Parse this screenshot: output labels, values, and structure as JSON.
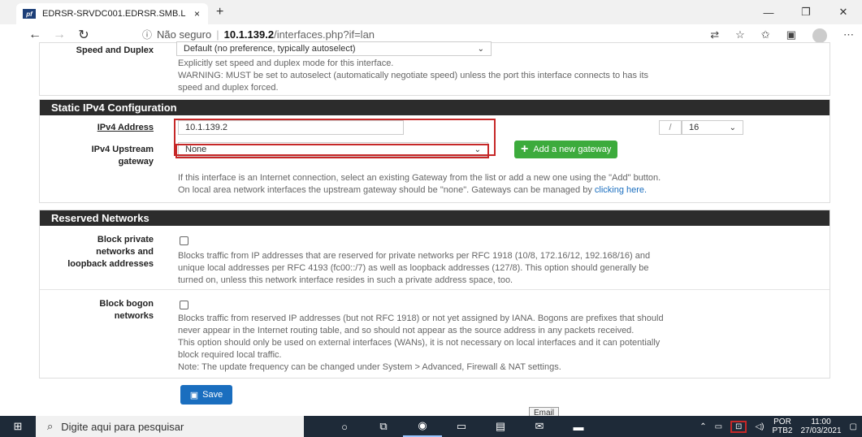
{
  "browser": {
    "tab_title": "EDRSR-SRVDC001.EDRSR.SMB.L",
    "tab_close": "×",
    "new_tab": "+",
    "favicon": "pf",
    "security": "Não seguro",
    "url_host": "10.1.139.2",
    "url_path": "/interfaces.php?if=lan",
    "window_controls": [
      "—",
      "❐",
      "✕"
    ]
  },
  "speed_duplex": {
    "label": "Speed and Duplex",
    "select_value": "Default (no preference, typically autoselect)",
    "help_1": "Explicitly set speed and duplex mode for this interface.",
    "help_2": "WARNING: MUST be set to autoselect (automatically negotiate speed) unless the port this interface connects to has its",
    "help_3": "speed and duplex forced."
  },
  "static_ipv4": {
    "heading": "Static IPv4 Configuration",
    "address_label": "IPv4 Address",
    "address_value": "10.1.139.2",
    "slash": "/",
    "cidr_value": "16",
    "upstream_label_1": "IPv4 Upstream",
    "upstream_label_2": "gateway",
    "upstream_value": "None",
    "add_gateway_label": "Add a new gateway",
    "help_1": "If this interface is an Internet connection, select an existing Gateway from the list or add a new one using the \"Add\" button.",
    "help_2": "On local area network interfaces the upstream gateway should be \"none\". Gateways can be managed by",
    "help_link": "clicking here."
  },
  "reserved": {
    "heading": "Reserved Networks",
    "private_label_1": "Block private",
    "private_label_2": "networks and",
    "private_label_3": "loopback addresses",
    "private_help_1": "Blocks traffic from IP addresses that are reserved for private networks per RFC 1918 (10/8, 172.16/12, 192.168/16) and",
    "private_help_2": "unique local addresses per RFC 4193 (fc00::/7) as well as loopback addresses (127/8). This option should generally be",
    "private_help_3": "turned on, unless this network interface resides in such a private address space, too.",
    "bogon_label_1": "Block bogon",
    "bogon_label_2": "networks",
    "bogon_help_1": "Blocks traffic from reserved IP addresses (but not RFC 1918) or not yet assigned by IANA. Bogons are prefixes that should",
    "bogon_help_2": "never appear in the Internet routing table, and so should not appear as the source address in any packets received.",
    "bogon_help_3": "This option should only be used on external interfaces (WANs), it is not necessary on local interfaces and it can potentially",
    "bogon_help_4": "block required local traffic.",
    "bogon_help_5": "Note: The update frequency can be changed under System > Advanced, Firewall & NAT settings."
  },
  "save_label": "Save",
  "tooltip": "Email",
  "taskbar": {
    "search_placeholder": "Digite aqui para pesquisar",
    "lang_1": "POR",
    "lang_2": "PTB2",
    "time": "11:00",
    "date": "27/03/2021"
  }
}
